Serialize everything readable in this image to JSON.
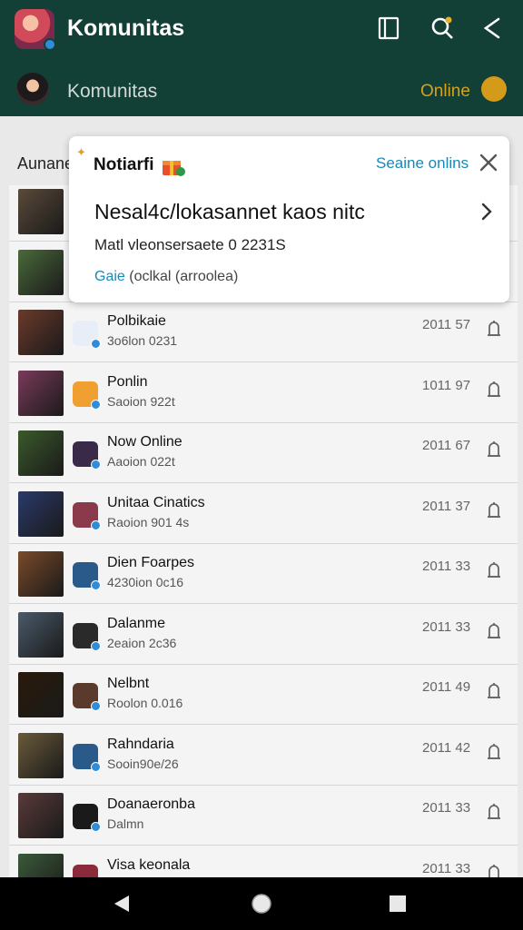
{
  "header": {
    "app_title": "Komunitas",
    "sub_title": "Komunitas",
    "online_label": "Online",
    "icons": [
      "book-icon",
      "search-icon",
      "share-icon"
    ]
  },
  "section_label": "Aunane",
  "notification": {
    "title": "Notiarfi",
    "online_action": "Seaine onlins",
    "heading": "Nesal4c/lokasannet kaos nitc",
    "body": "Matl vleonsersaete 0 2231S",
    "link_label": "Gaie",
    "link_rest": "(oclkal (arroolea)"
  },
  "list": [
    {
      "title": "",
      "sub": "",
      "time": "",
      "thumb": "#5a4a3a",
      "badge": "#2b3e7a"
    },
    {
      "title": "",
      "sub": "",
      "time": "",
      "thumb": "#4b6a3a",
      "badge": "#2f6a4a"
    },
    {
      "title": "Polbikaie",
      "sub": "3o6lon 0231",
      "time": "2011 57",
      "thumb": "#6b3a2a",
      "badge": "#e7eef7"
    },
    {
      "title": "Ponlin",
      "sub": "Saoion 922t",
      "time": "1011 97",
      "thumb": "#7a3a5a",
      "badge": "#f0a030"
    },
    {
      "title": "Now Online",
      "sub": "Aaoion 022t",
      "time": "2011 67",
      "thumb": "#3a5a2a",
      "badge": "#3a2a4a"
    },
    {
      "title": "Unitaa Cinatics",
      "sub": "Raoion 901 4s",
      "time": "2011 37",
      "thumb": "#2a3a6a",
      "badge": "#8a3a4a"
    },
    {
      "title": "Dien Foarpes",
      "sub": "4230ion 0c16",
      "time": "2011 33",
      "thumb": "#7a4a2a",
      "badge": "#2a5a8a"
    },
    {
      "title": "Dalanme",
      "sub": "2eaion 2c36",
      "time": "2011 33",
      "thumb": "#4a5a6a",
      "badge": "#2a2a2a"
    },
    {
      "title": "Nelbnt",
      "sub": "Roolon 0.016",
      "time": "2011 49",
      "thumb": "#2a1a0a",
      "badge": "#5a3a2a"
    },
    {
      "title": "Rahndaria",
      "sub": "Sooin90e/26",
      "time": "2011 42",
      "thumb": "#6a5a3a",
      "badge": "#2a5a8a"
    },
    {
      "title": "Doanaeronba",
      "sub": "Dalmn",
      "time": "2011 33",
      "thumb": "#5a3a3a",
      "badge": "#1a1a1a"
    },
    {
      "title": "Visa keonala",
      "sub": "",
      "time": "2011 33",
      "thumb": "#3a5a3a",
      "badge": "#8a2a3a"
    }
  ],
  "colors": {
    "header_bg": "#123f36",
    "accent_link": "#1789b8",
    "online_gold": "#d6a21c",
    "nav_bg": "#000000"
  }
}
